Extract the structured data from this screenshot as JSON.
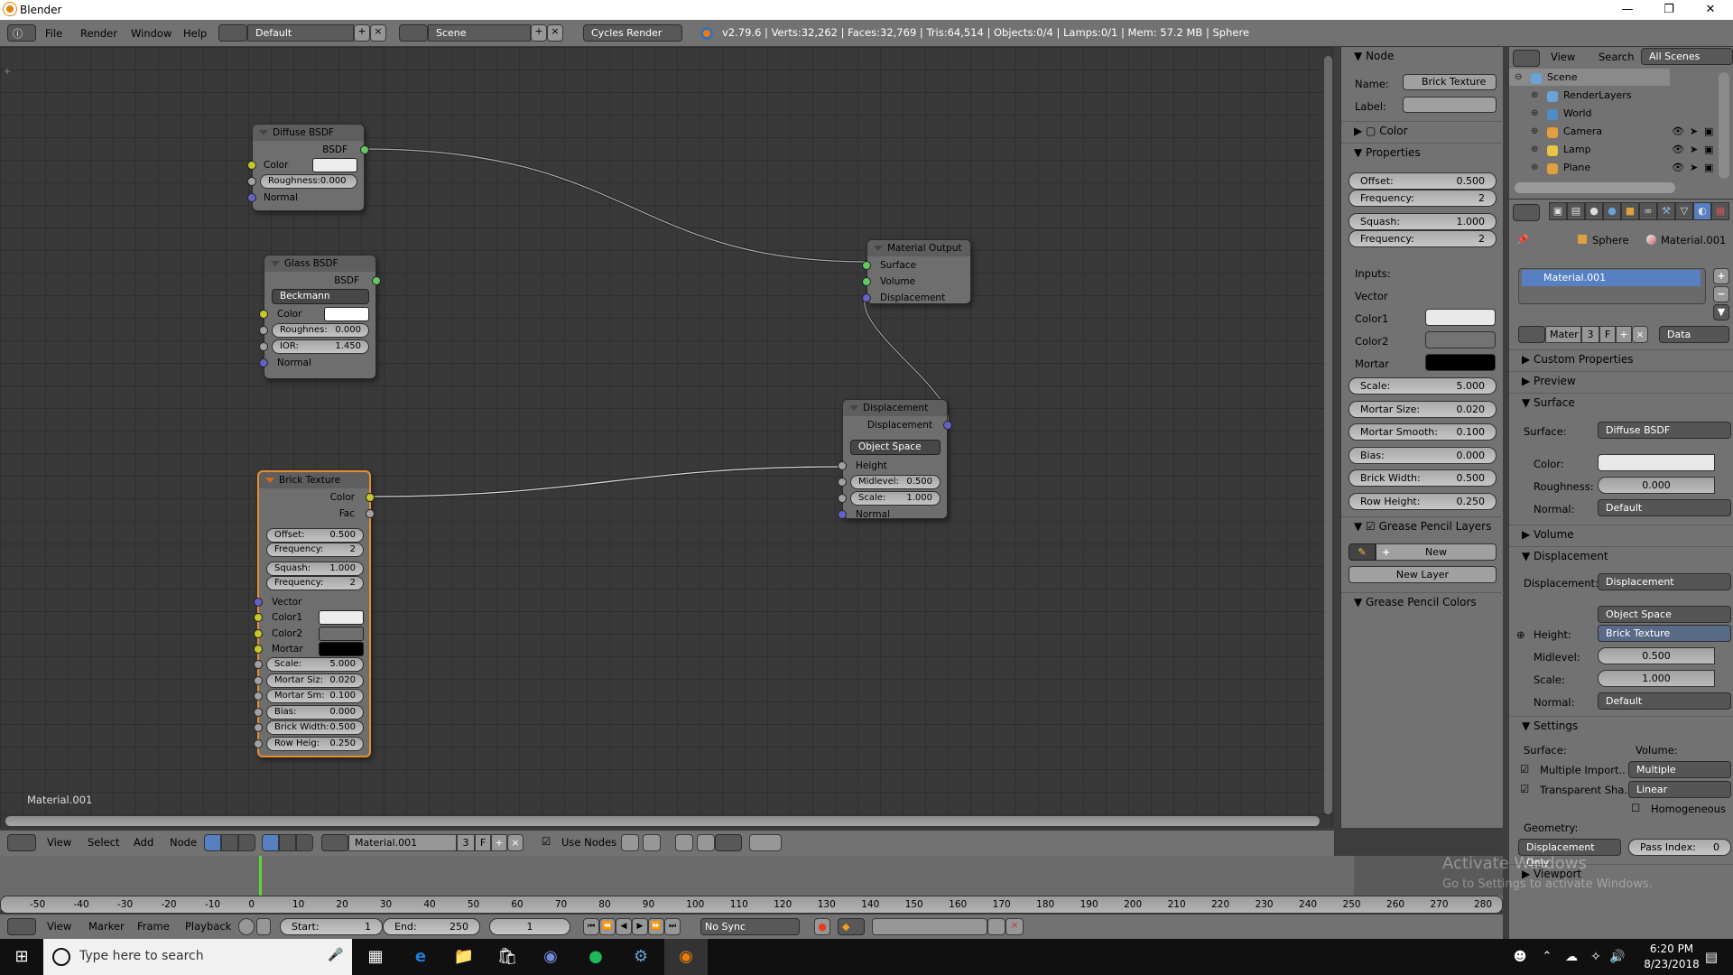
{
  "window": {
    "title": "Blender",
    "controls": [
      "minimize",
      "restore",
      "close"
    ]
  },
  "info_header": {
    "menus": [
      "File",
      "Render",
      "Window",
      "Help"
    ],
    "screen_layout": "Default",
    "scene": "Scene",
    "render_engine": "Cycles Render",
    "stats": "v2.79.6 | Verts:32,262 | Faces:32,769 | Tris:64,514 | Objects:0/4 | Lamps:0/1 | Mem: 57.2 MB | Sphere"
  },
  "node_editor": {
    "material_label": "Material.001",
    "nodes": {
      "diffuse": {
        "title": "Diffuse BSDF",
        "output": "BSDF",
        "color_label": "Color",
        "roughness": "Roughness:0.000",
        "normal": "Normal"
      },
      "glass": {
        "title": "Glass BSDF",
        "output": "BSDF",
        "distribution": "Beckmann",
        "color_label": "Color",
        "roughness_label": "Roughnes:",
        "roughness_value": "0.000",
        "ior_label": "IOR:",
        "ior_value": "1.450",
        "normal": "Normal"
      },
      "material_output": {
        "title": "Material Output",
        "inputs": [
          "Surface",
          "Volume",
          "Displacement"
        ]
      },
      "displacement": {
        "title": "Displacement",
        "output": "Displacement",
        "space": "Object Space",
        "height": "Height",
        "midlevel_label": "Midlevel:",
        "midlevel_value": "0.500",
        "scale_label": "Scale:",
        "scale_value": "1.000",
        "normal": "Normal"
      },
      "brick": {
        "title": "Brick Texture",
        "outputs": [
          "Color",
          "Fac"
        ],
        "offset_label": "Offset:",
        "offset_value": "0.500",
        "freq1_label": "Frequency:",
        "freq1_value": "2",
        "squash_label": "Squash:",
        "squash_value": "1.000",
        "freq2_label": "Frequency:",
        "freq2_value": "2",
        "vector": "Vector",
        "color1": "Color1",
        "color2": "Color2",
        "mortar": "Mortar",
        "fields": [
          {
            "label": "Scale:",
            "value": "5.000"
          },
          {
            "label": "Mortar Siz:",
            "value": "0.020"
          },
          {
            "label": "Mortar Sm:",
            "value": "0.100"
          },
          {
            "label": "Bias:",
            "value": "0.000"
          },
          {
            "label": "Brick Width:",
            "value": "0.500"
          },
          {
            "label": "Row Heig:",
            "value": "0.250"
          }
        ]
      }
    }
  },
  "n_panel": {
    "node_section": "Node",
    "name_label": "Name:",
    "name_value": "Brick Texture",
    "label_label": "Label:",
    "color_section": "Color",
    "properties_section": "Properties",
    "offset_label": "Offset:",
    "offset_value": "0.500",
    "freq1_label": "Frequency:",
    "freq1_value": "2",
    "squash_label": "Squash:",
    "squash_value": "1.000",
    "freq2_label": "Frequency:",
    "freq2_value": "2",
    "inputs_label": "Inputs:",
    "vector_label": "Vector",
    "color1_label": "Color1",
    "color2_label": "Color2",
    "mortar_label": "Mortar",
    "fields": [
      {
        "label": "Scale:",
        "value": "5.000"
      },
      {
        "label": "Mortar Size:",
        "value": "0.020"
      },
      {
        "label": "Mortar Smooth:",
        "value": "0.100"
      },
      {
        "label": "Bias:",
        "value": "0.000"
      },
      {
        "label": "Brick Width:",
        "value": "0.500"
      },
      {
        "label": "Row Height:",
        "value": "0.250"
      }
    ],
    "gp_layers_section": "Grease Pencil Layers",
    "new_button": "New",
    "new_layer_button": "New Layer",
    "gp_colors_section": "Grease Pencil Colors"
  },
  "outliner": {
    "menus": [
      "View",
      "Search"
    ],
    "filter": "All Scenes",
    "items": [
      {
        "label": "Scene",
        "depth": 0
      },
      {
        "label": "RenderLayers",
        "depth": 1
      },
      {
        "label": "World",
        "depth": 1
      },
      {
        "label": "Camera",
        "depth": 1
      },
      {
        "label": "Lamp",
        "depth": 1
      },
      {
        "label": "Plane",
        "depth": 1
      }
    ]
  },
  "properties": {
    "breadcrumb": [
      "Sphere",
      "Material.001"
    ],
    "material_slot": "Material.001",
    "datablock_name": "Mater",
    "users": "3",
    "fake_user": "F",
    "link": "Data",
    "sections": {
      "custom": "Custom Properties",
      "preview": "Preview",
      "surface": "Surface",
      "volume": "Volume",
      "displacement": "Displacement",
      "settings": "Settings",
      "viewport": "Viewport"
    },
    "surface": {
      "surface_label": "Surface:",
      "surface_value": "Diffuse BSDF",
      "color_label": "Color:",
      "roughness_label": "Roughness:",
      "roughness_value": "0.000",
      "normal_label": "Normal:",
      "normal_value": "Default"
    },
    "displacement": {
      "disp_label": "Displacement:",
      "disp_value": "Displacement",
      "space": "Object Space",
      "height_label": "Height:",
      "height_value": "Brick Texture",
      "midlevel_label": "Midlevel:",
      "midlevel_value": "0.500",
      "scale_label": "Scale:",
      "scale_value": "1.000",
      "normal_label": "Normal:",
      "normal_value": "Default"
    },
    "settings": {
      "surface_label": "Surface:",
      "volume_label": "Volume:",
      "multiple_importance": "Multiple Import..",
      "transparent_shadows": "Transparent Sha..",
      "volume_sampling": "Multiple Importan..",
      "volume_interp": "Linear",
      "homogeneous": "Homogeneous",
      "geometry_label": "Geometry:",
      "geometry_value": "Displacement Only",
      "pass_index_label": "Pass Index:",
      "pass_index_value": "0"
    }
  },
  "node_header": {
    "menus": [
      "View",
      "Select",
      "Add",
      "Node"
    ],
    "material": "Material.001",
    "users": "3",
    "fake_user": "F",
    "use_nodes": "Use Nodes"
  },
  "timeline": {
    "ticks": [
      "-50",
      "-40",
      "-30",
      "-20",
      "-10",
      "0",
      "10",
      "20",
      "30",
      "40",
      "50",
      "60",
      "70",
      "80",
      "90",
      "100",
      "110",
      "120",
      "130",
      "140",
      "150",
      "160",
      "170",
      "180",
      "190",
      "200",
      "210",
      "220",
      "230",
      "240",
      "250",
      "260",
      "270",
      "280"
    ],
    "menus": [
      "View",
      "Marker",
      "Frame",
      "Playback"
    ],
    "start_label": "Start:",
    "start_value": "1",
    "end_label": "End:",
    "end_value": "250",
    "current_frame": "1",
    "sync": "No Sync"
  },
  "watermark": {
    "line1": "Activate Windows",
    "line2": "Go to Settings to activate Windows."
  },
  "taskbar": {
    "search_placeholder": "Type here to search",
    "time": "6:20 PM",
    "date": "8/23/2018"
  }
}
